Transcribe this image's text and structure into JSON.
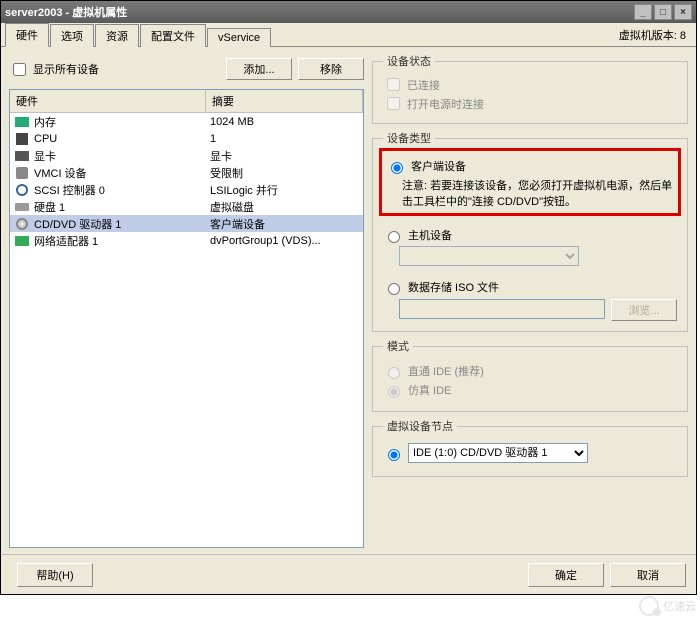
{
  "title": "server2003 - 虚拟机属性",
  "tabs": [
    "硬件",
    "选项",
    "资源",
    "配置文件",
    "vService"
  ],
  "active_tab": 0,
  "version_label": "虚拟机版本: 8",
  "show_all_label": "显示所有设备",
  "add_btn": "添加...",
  "remove_btn": "移除",
  "hw_header": {
    "col1": "硬件",
    "col2": "摘要"
  },
  "hw_rows": [
    {
      "icon": "mem",
      "name": "内存",
      "summary": "1024 MB"
    },
    {
      "icon": "cpu",
      "name": "CPU",
      "summary": "1"
    },
    {
      "icon": "vid",
      "name": "显卡",
      "summary": "显卡"
    },
    {
      "icon": "vmci",
      "name": "VMCI 设备",
      "summary": "受限制"
    },
    {
      "icon": "scsi",
      "name": "SCSI 控制器 0",
      "summary": "LSILogic 并行"
    },
    {
      "icon": "disk",
      "name": "硬盘 1",
      "summary": "虚拟磁盘"
    },
    {
      "icon": "cd",
      "name": "CD/DVD 驱动器 1",
      "summary": "客户端设备",
      "selected": true
    },
    {
      "icon": "net",
      "name": "网络适配器 1",
      "summary": "dvPortGroup1 (VDS)..."
    }
  ],
  "status": {
    "legend": "设备状态",
    "connected": "已连接",
    "connect_at_poweron": "打开电源时连接"
  },
  "device_type": {
    "legend": "设备类型",
    "client": "客户端设备",
    "client_note": "注意: 若要连接该设备，您必须打开虚拟机电源，然后单击工具栏中的\"连接 CD/DVD\"按钮。",
    "host": "主机设备",
    "iso": "数据存储 ISO 文件",
    "browse_btn": "浏览..."
  },
  "mode": {
    "legend": "模式",
    "passthrough": "直通 IDE (推荐)",
    "emulate": "仿真 IDE"
  },
  "vnode": {
    "legend": "虚拟设备节点",
    "value": "IDE (1:0) CD/DVD 驱动器 1"
  },
  "footer": {
    "help": "帮助(H)",
    "ok": "确定",
    "cancel": "取消"
  },
  "watermark": "亿速云"
}
